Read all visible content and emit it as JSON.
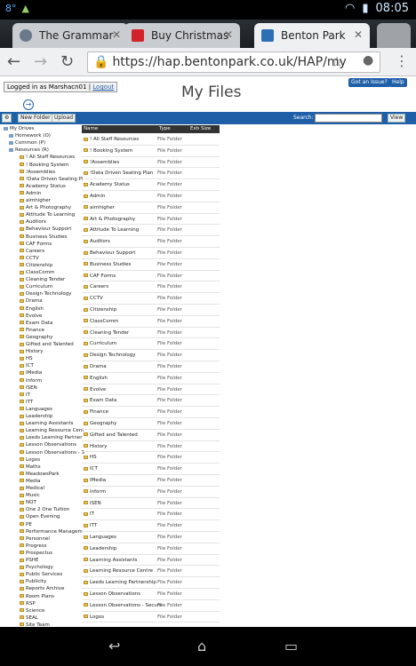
{
  "status": {
    "temp": "8°",
    "time": "08:05"
  },
  "tabs": [
    {
      "label": "The Grammar",
      "close": "✕"
    },
    {
      "label": "Buy Christmas",
      "close": "✕"
    },
    {
      "label": "Benton Park",
      "close": "✕"
    }
  ],
  "address": {
    "url": "https://hap.bentonpark.co.uk/HAP/my"
  },
  "header": {
    "logged_in": "Logged in as Marshacn01",
    "logout": "Logout",
    "issue_btn": "Got an Issue?",
    "help_btn": "Help",
    "title": "My Files"
  },
  "toolbar": {
    "new_folder": "New Folder",
    "upload": "Upload",
    "search_label": "Search:",
    "view": "View"
  },
  "tree": {
    "root": "My Drives",
    "drives": [
      "Homework (O)",
      "Common (P)",
      "Resources (R)"
    ],
    "folders": [
      "! All Staff Resources",
      "! Booking System",
      "!Assemblies",
      "!Data Driven Seating Pl",
      "Academy Status",
      "Admin",
      "aimhigher",
      "Art & Photography",
      "Attitude To Learning",
      "Auditors",
      "Behaviour Support",
      "Business Studies",
      "CAF Forms",
      "Careers",
      "CCTV",
      "Citizenship",
      "ClassComm",
      "Cleaning Tender",
      "Curriculum",
      "Design Technology",
      "Drama",
      "English",
      "Evolve",
      "Exam Data",
      "Finance",
      "Geography",
      "Gifted and Talented",
      "History",
      "HS",
      "ICT",
      "IMedia",
      "Inform",
      "ISEN",
      "IT",
      "ITT",
      "Languages",
      "Leadership",
      "Learning Assistants",
      "Learning Resource Cent",
      "Leeds Learning Partner",
      "Lesson Observations",
      "Lesson Observations - S",
      "Logos",
      "Maths",
      "MeadowsPark",
      "Media",
      "Medical",
      "Music",
      "NQT",
      "One 2 One Tuition",
      "Open Evening",
      "PE",
      "Performance Managem",
      "Personnel",
      "Progress",
      "Prospectus",
      "PSHE",
      "Psychology",
      "Public Services",
      "Publicity",
      "Reports Archive",
      "Room Plans",
      "RSP",
      "Science",
      "SEAL",
      "Site Team"
    ]
  },
  "grid": {
    "headers": [
      "Name",
      "Type",
      "Exte",
      "Size"
    ],
    "type_value": "File Folder",
    "rows": [
      "! All Staff Resources",
      "! Booking System",
      "!Assemblies",
      "!Data Driven Seating Plan",
      "Academy Status",
      "Admin",
      "aimhigher",
      "Art & Photography",
      "Attitude To Learning",
      "Auditors",
      "Behaviour Support",
      "Business Studies",
      "CAF Forms",
      "Careers",
      "CCTV",
      "Citizenship",
      "ClassComm",
      "Cleaning Tender",
      "Curriculum",
      "Design Technology",
      "Drama",
      "English",
      "Evolve",
      "Exam Data",
      "Finance",
      "Geography",
      "Gifted and Talented",
      "History",
      "HS",
      "ICT",
      "IMedia",
      "Inform",
      "ISEN",
      "IT",
      "ITT",
      "Languages",
      "Leadership",
      "Learning Assistants",
      "Learning Resource Centre",
      "Leeds Learning Partnership",
      "Lesson Observations",
      "Lesson Observations - Secure",
      "Logos"
    ]
  }
}
